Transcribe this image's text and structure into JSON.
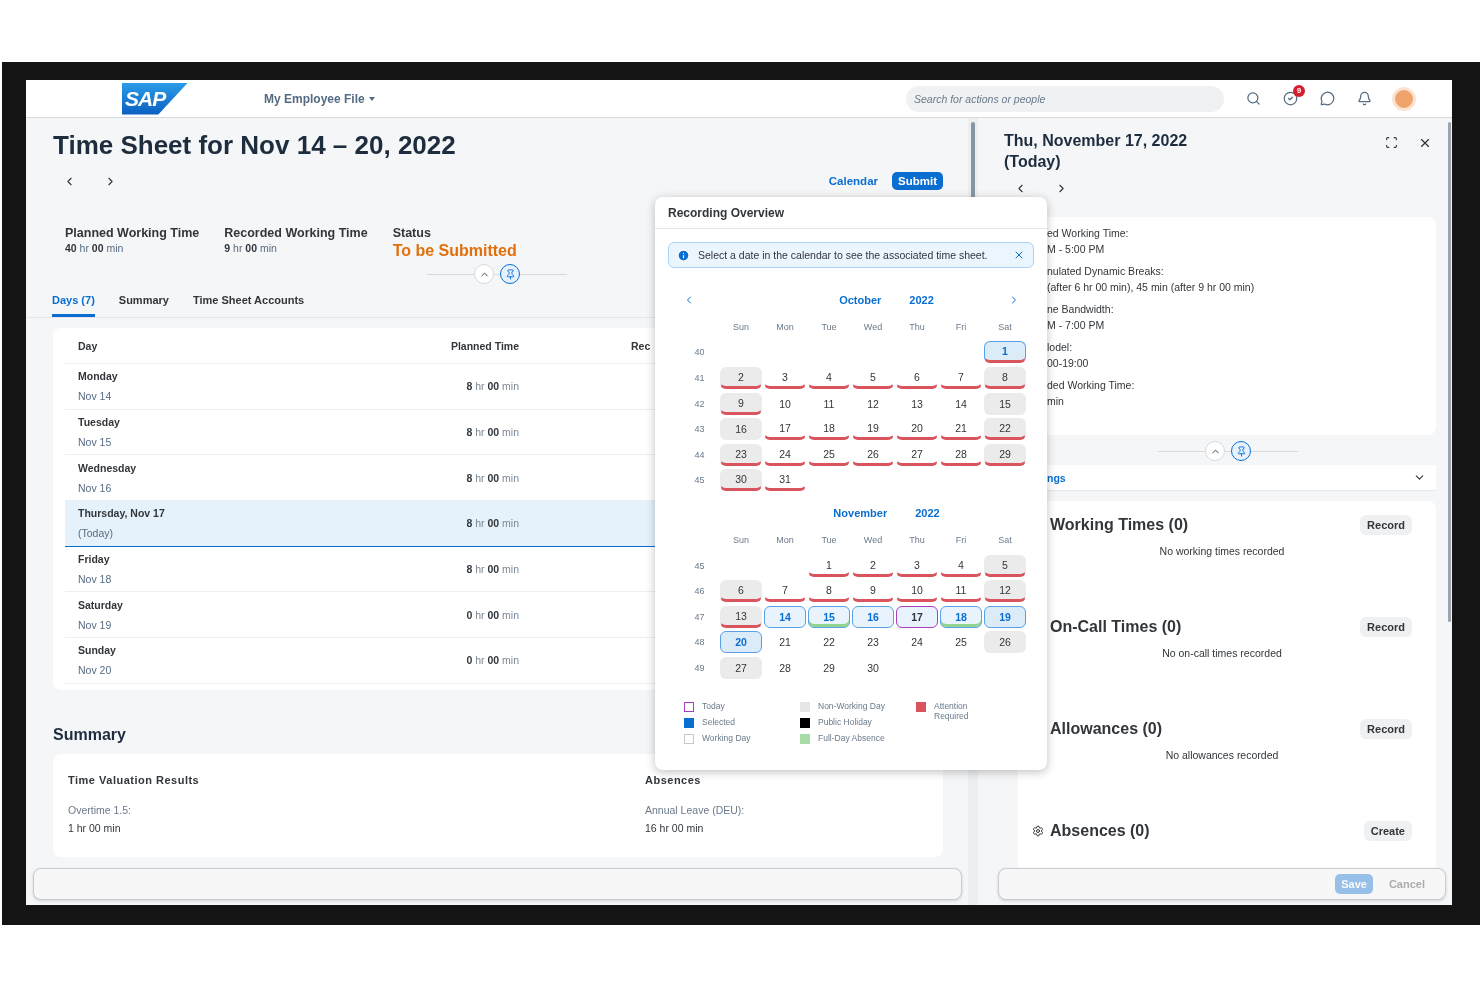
{
  "shell": {
    "logo": "SAP",
    "menu": "My Employee File",
    "search_placeholder": "Search for actions or people",
    "notification_count": "9"
  },
  "page": {
    "title": "Time Sheet for Nov 14 – 20, 2022",
    "actions": [
      {
        "label": "Calendar",
        "kind": "link"
      },
      {
        "label": "Submit",
        "kind": "primary"
      }
    ],
    "kpis": [
      {
        "label": "Planned Working Time",
        "value": "**40** hr  **00** min",
        "kind": "time"
      },
      {
        "label": "Recorded Working Time",
        "value": "**9** hr  **00** min",
        "kind": "time"
      },
      {
        "label": "Status",
        "value": "To be Submitted",
        "kind": "status"
      }
    ],
    "tabs": [
      {
        "label": "Days (7)",
        "selected": true
      },
      {
        "label": "Summary",
        "selected": false
      },
      {
        "label": "Time Sheet Accounts",
        "selected": false
      }
    ],
    "table": {
      "columns": [
        "Day",
        "Planned Time",
        "Rec"
      ],
      "rows": [
        {
          "day": "Monday",
          "date": "Nov 14",
          "planned": "**8** hr  **00** min",
          "selected": false
        },
        {
          "day": "Tuesday",
          "date": "Nov 15",
          "planned": "**8** hr  **00** min",
          "selected": false
        },
        {
          "day": "Wednesday",
          "date": "Nov 16",
          "planned": "**8** hr  **00** min",
          "selected": false
        },
        {
          "day": "Thursday, Nov 17",
          "date": "(Today)",
          "planned": "**8** hr  **00** min",
          "selected": true
        },
        {
          "day": "Friday",
          "date": "Nov 18",
          "planned": "**8** hr  **00** min",
          "selected": false
        },
        {
          "day": "Saturday",
          "date": "Nov 19",
          "planned": "**0** hr  **00** min",
          "selected": false
        },
        {
          "day": "Sunday",
          "date": "Nov 20",
          "planned": "**0** hr  **00** min",
          "selected": false
        }
      ]
    },
    "summary": {
      "title": "Summary",
      "groups": [
        {
          "title": "Time Valuation Results",
          "label": "Overtime 1.5:",
          "value": "1 hr 00 min"
        },
        {
          "title": "Absences",
          "label": "Annual Leave (DEU):",
          "value": "16 hr 00 min"
        }
      ]
    }
  },
  "detail": {
    "title": "Thu, November 17, 2022",
    "subtitle": "(Today)",
    "info": [
      {
        "label": "ed Working Time:",
        "value": "M - 5:00 PM"
      },
      {
        "label": "nulated Dynamic Breaks:",
        "value": "(after 6 hr 00 min), 45 min (after 9 hr 00 min)"
      },
      {
        "label": "ne Bandwidth:",
        "value": "M - 7:00 PM"
      },
      {
        "label": "lodel:",
        "value": "00-19:00"
      },
      {
        "label": "ded Working Time:",
        "value": "min"
      }
    ],
    "section_bar": "ngs",
    "sections": [
      {
        "title": "Working Times (0)",
        "button": "Record",
        "empty_text": "No working times recorded",
        "kind": "plain"
      },
      {
        "title": "On-Call Times (0)",
        "button": "Record",
        "empty_text": "No on-call times recorded",
        "kind": "plain"
      },
      {
        "title": "Allowances (0)",
        "button": "Record",
        "empty_text": "No allowances recorded",
        "kind": "plain"
      },
      {
        "title": "Absences (0)",
        "button": "Create",
        "kind": "with-icon"
      }
    ],
    "footer": [
      {
        "label": "Save",
        "kind": "primary",
        "disabled": true
      },
      {
        "label": "Cancel",
        "kind": "plain",
        "disabled": true
      }
    ]
  },
  "popover": {
    "title": "Recording Overview",
    "message": "Select a date in the calendar to see the associated time sheet.",
    "months": [
      {
        "month": "October",
        "year": "2022",
        "nav": true,
        "weekdays": [
          "Sun",
          "Mon",
          "Tue",
          "Wed",
          "Thu",
          "Fri",
          "Sat"
        ],
        "weeks": [
          {
            "number": "40",
            "days": [
              {
                "kind": "blank"
              },
              {
                "kind": "blank"
              },
              {
                "kind": "blank"
              },
              {
                "kind": "blank"
              },
              {
                "kind": "blank"
              },
              {
                "kind": "blank"
              },
              {
                "kind": "day",
                "d": "1",
                "non_working": true,
                "attention": true,
                "absence": false,
                "selected": true,
                "today": false
              }
            ]
          },
          {
            "number": "41",
            "days": [
              {
                "kind": "day",
                "d": "2",
                "non_working": true,
                "attention": true,
                "absence": false,
                "selected": false,
                "today": false
              },
              {
                "kind": "day",
                "d": "3",
                "non_working": false,
                "attention": true,
                "absence": false,
                "selected": false,
                "today": false
              },
              {
                "kind": "day",
                "d": "4",
                "non_working": false,
                "attention": true,
                "absence": false,
                "selected": false,
                "today": false
              },
              {
                "kind": "day",
                "d": "5",
                "non_working": false,
                "attention": true,
                "absence": false,
                "selected": false,
                "today": false
              },
              {
                "kind": "day",
                "d": "6",
                "non_working": false,
                "attention": true,
                "absence": false,
                "selected": false,
                "today": false
              },
              {
                "kind": "day",
                "d": "7",
                "non_working": false,
                "attention": true,
                "absence": false,
                "selected": false,
                "today": false
              },
              {
                "kind": "day",
                "d": "8",
                "non_working": true,
                "attention": true,
                "absence": false,
                "selected": false,
                "today": false
              }
            ]
          },
          {
            "number": "42",
            "days": [
              {
                "kind": "day",
                "d": "9",
                "non_working": true,
                "attention": true,
                "absence": false,
                "selected": false,
                "today": false
              },
              {
                "kind": "day",
                "d": "10",
                "non_working": false,
                "attention": false,
                "absence": false,
                "selected": false,
                "today": false
              },
              {
                "kind": "day",
                "d": "11",
                "non_working": false,
                "attention": false,
                "absence": false,
                "selected": false,
                "today": false
              },
              {
                "kind": "day",
                "d": "12",
                "non_working": false,
                "attention": false,
                "absence": false,
                "selected": false,
                "today": false
              },
              {
                "kind": "day",
                "d": "13",
                "non_working": false,
                "attention": false,
                "absence": false,
                "selected": false,
                "today": false
              },
              {
                "kind": "day",
                "d": "14",
                "non_working": false,
                "attention": false,
                "absence": false,
                "selected": false,
                "today": false
              },
              {
                "kind": "day",
                "d": "15",
                "non_working": true,
                "attention": false,
                "absence": false,
                "selected": false,
                "today": false
              }
            ]
          },
          {
            "number": "43",
            "days": [
              {
                "kind": "day",
                "d": "16",
                "non_working": true,
                "attention": false,
                "absence": false,
                "selected": false,
                "today": false
              },
              {
                "kind": "day",
                "d": "17",
                "non_working": false,
                "attention": true,
                "absence": false,
                "selected": false,
                "today": false
              },
              {
                "kind": "day",
                "d": "18",
                "non_working": false,
                "attention": true,
                "absence": false,
                "selected": false,
                "today": false
              },
              {
                "kind": "day",
                "d": "19",
                "non_working": false,
                "attention": true,
                "absence": false,
                "selected": false,
                "today": false
              },
              {
                "kind": "day",
                "d": "20",
                "non_working": false,
                "attention": true,
                "absence": false,
                "selected": false,
                "today": false
              },
              {
                "kind": "day",
                "d": "21",
                "non_working": false,
                "attention": true,
                "absence": false,
                "selected": false,
                "today": false
              },
              {
                "kind": "day",
                "d": "22",
                "non_working": true,
                "attention": true,
                "absence": false,
                "selected": false,
                "today": false
              }
            ]
          },
          {
            "number": "44",
            "days": [
              {
                "kind": "day",
                "d": "23",
                "non_working": true,
                "attention": true,
                "absence": false,
                "selected": false,
                "today": false
              },
              {
                "kind": "day",
                "d": "24",
                "non_working": false,
                "attention": true,
                "absence": false,
                "selected": false,
                "today": false
              },
              {
                "kind": "day",
                "d": "25",
                "non_working": false,
                "attention": true,
                "absence": false,
                "selected": false,
                "today": false
              },
              {
                "kind": "day",
                "d": "26",
                "non_working": false,
                "attention": true,
                "absence": false,
                "selected": false,
                "today": false
              },
              {
                "kind": "day",
                "d": "27",
                "non_working": false,
                "attention": true,
                "absence": false,
                "selected": false,
                "today": false
              },
              {
                "kind": "day",
                "d": "28",
                "non_working": false,
                "attention": true,
                "absence": false,
                "selected": false,
                "today": false
              },
              {
                "kind": "day",
                "d": "29",
                "non_working": true,
                "attention": true,
                "absence": false,
                "selected": false,
                "today": false
              }
            ]
          },
          {
            "number": "45",
            "days": [
              {
                "kind": "day",
                "d": "30",
                "non_working": true,
                "attention": true,
                "absence": false,
                "selected": false,
                "today": false
              },
              {
                "kind": "day",
                "d": "31",
                "non_working": false,
                "attention": true,
                "absence": false,
                "selected": false,
                "today": false
              }
            ]
          }
        ]
      },
      {
        "month": "November",
        "year": "2022",
        "nav": false,
        "weekdays": [
          "Sun",
          "Mon",
          "Tue",
          "Wed",
          "Thu",
          "Fri",
          "Sat"
        ],
        "weeks": [
          {
            "number": "45",
            "days": [
              {
                "kind": "blank"
              },
              {
                "kind": "blank"
              },
              {
                "kind": "day",
                "d": "1",
                "non_working": false,
                "attention": true,
                "absence": false,
                "selected": false,
                "today": false
              },
              {
                "kind": "day",
                "d": "2",
                "non_working": false,
                "attention": true,
                "absence": false,
                "selected": false,
                "today": false
              },
              {
                "kind": "day",
                "d": "3",
                "non_working": false,
                "attention": true,
                "absence": false,
                "selected": false,
                "today": false
              },
              {
                "kind": "day",
                "d": "4",
                "non_working": false,
                "attention": true,
                "absence": false,
                "selected": false,
                "today": false
              },
              {
                "kind": "day",
                "d": "5",
                "non_working": true,
                "attention": true,
                "absence": false,
                "selected": false,
                "today": false
              }
            ]
          },
          {
            "number": "46",
            "days": [
              {
                "kind": "day",
                "d": "6",
                "non_working": true,
                "attention": true,
                "absence": false,
                "selected": false,
                "today": false
              },
              {
                "kind": "day",
                "d": "7",
                "non_working": false,
                "attention": true,
                "absence": false,
                "selected": false,
                "today": false
              },
              {
                "kind": "day",
                "d": "8",
                "non_working": false,
                "attention": true,
                "absence": false,
                "selected": false,
                "today": false
              },
              {
                "kind": "day",
                "d": "9",
                "non_working": false,
                "attention": true,
                "absence": false,
                "selected": false,
                "today": false
              },
              {
                "kind": "day",
                "d": "10",
                "non_working": false,
                "attention": true,
                "absence": false,
                "selected": false,
                "today": false
              },
              {
                "kind": "day",
                "d": "11",
                "non_working": false,
                "attention": true,
                "absence": false,
                "selected": false,
                "today": false
              },
              {
                "kind": "day",
                "d": "12",
                "non_working": true,
                "attention": true,
                "absence": false,
                "selected": false,
                "today": false
              }
            ]
          },
          {
            "number": "47",
            "days": [
              {
                "kind": "day",
                "d": "13",
                "non_working": true,
                "attention": true,
                "absence": false,
                "selected": false,
                "today": false
              },
              {
                "kind": "day",
                "d": "14",
                "non_working": false,
                "attention": false,
                "absence": false,
                "selected": true,
                "today": false
              },
              {
                "kind": "day",
                "d": "15",
                "non_working": false,
                "attention": false,
                "absence": true,
                "selected": true,
                "today": false
              },
              {
                "kind": "day",
                "d": "16",
                "non_working": false,
                "attention": false,
                "absence": false,
                "selected": true,
                "today": false
              },
              {
                "kind": "day",
                "d": "17",
                "non_working": false,
                "attention": false,
                "absence": false,
                "selected": true,
                "today": true
              },
              {
                "kind": "day",
                "d": "18",
                "non_working": false,
                "attention": false,
                "absence": true,
                "selected": true,
                "today": false
              },
              {
                "kind": "day",
                "d": "19",
                "non_working": true,
                "attention": false,
                "absence": false,
                "selected": true,
                "today": false
              }
            ]
          },
          {
            "number": "48",
            "days": [
              {
                "kind": "day",
                "d": "20",
                "non_working": true,
                "attention": false,
                "absence": false,
                "selected": true,
                "today": false
              },
              {
                "kind": "day",
                "d": "21",
                "non_working": false,
                "attention": false,
                "absence": false,
                "selected": false,
                "today": false
              },
              {
                "kind": "day",
                "d": "22",
                "non_working": false,
                "attention": false,
                "absence": false,
                "selected": false,
                "today": false
              },
              {
                "kind": "day",
                "d": "23",
                "non_working": false,
                "attention": false,
                "absence": false,
                "selected": false,
                "today": false
              },
              {
                "kind": "day",
                "d": "24",
                "non_working": false,
                "attention": false,
                "absence": false,
                "selected": false,
                "today": false
              },
              {
                "kind": "day",
                "d": "25",
                "non_working": false,
                "attention": false,
                "absence": false,
                "selected": false,
                "today": false
              },
              {
                "kind": "day",
                "d": "26",
                "non_working": true,
                "attention": false,
                "absence": false,
                "selected": false,
                "today": false
              }
            ]
          },
          {
            "number": "49",
            "days": [
              {
                "kind": "day",
                "d": "27",
                "non_working": true,
                "attention": false,
                "absence": false,
                "selected": false,
                "today": false
              },
              {
                "kind": "day",
                "d": "28",
                "non_working": false,
                "attention": false,
                "absence": false,
                "selected": false,
                "today": false
              },
              {
                "kind": "day",
                "d": "29",
                "non_working": false,
                "attention": false,
                "absence": false,
                "selected": false,
                "today": false
              },
              {
                "kind": "day",
                "d": "30",
                "non_working": false,
                "attention": false,
                "absence": false,
                "selected": false,
                "today": false
              }
            ]
          }
        ]
      }
    ],
    "legend": [
      {
        "label": "Today",
        "kind": "outline",
        "color": "#a93fc0"
      },
      {
        "label": "Selected",
        "kind": "fill",
        "color": "#0a6ed1"
      },
      {
        "label": "Working Day",
        "kind": "outline",
        "color": "#c8c8c8"
      },
      {
        "label": "Non-Working Day",
        "kind": "fill",
        "color": "#e6e6e6"
      },
      {
        "label": "Public Holiday",
        "kind": "fill",
        "color": "#000000"
      },
      {
        "label": "Full-Day Absence",
        "kind": "fill",
        "color": "#a6dca6"
      },
      {
        "label": "Attention Required",
        "kind": "fill",
        "color": "#d9545c"
      }
    ]
  }
}
